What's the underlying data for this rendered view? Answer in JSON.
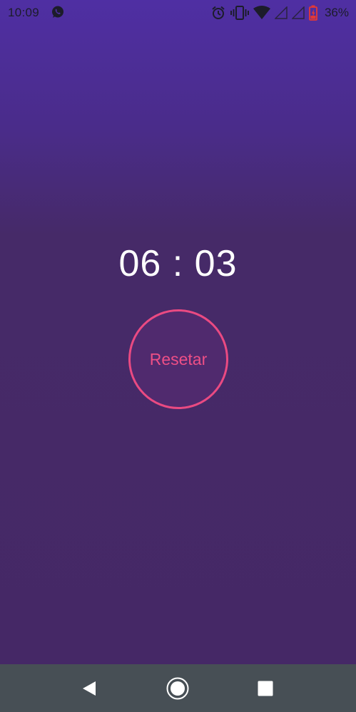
{
  "status_bar": {
    "time": "10:09",
    "battery_percent": "36%",
    "icons": [
      "whatsapp-icon",
      "alarm-icon",
      "vibrate-icon",
      "wifi-icon",
      "signal-icon",
      "signal-icon",
      "battery-charging-icon"
    ],
    "battery_color": "#e53935"
  },
  "timer": {
    "display": "06 : 03"
  },
  "reset_button": {
    "label": "Resetar",
    "accent_color": "#ea4a82"
  },
  "navigation_bar": {
    "buttons": [
      "back-icon",
      "home-icon",
      "recent-apps-icon"
    ]
  },
  "colors": {
    "background_top": "#4f2fa3",
    "background": "#452866",
    "nav_bar": "#474f55"
  }
}
